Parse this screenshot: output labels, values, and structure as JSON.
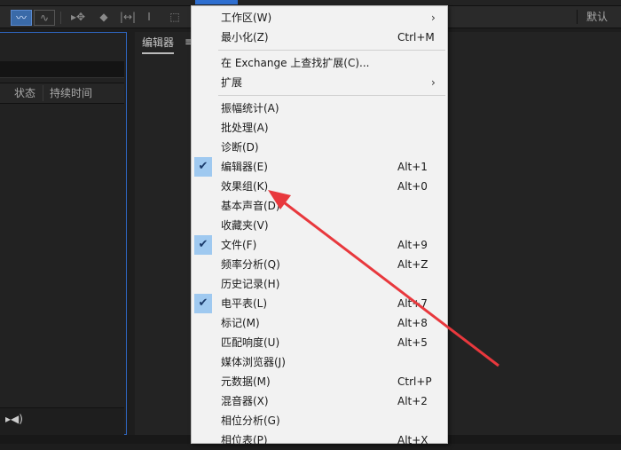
{
  "toolbar": {
    "default_label": "默认"
  },
  "left_panel": {
    "columns": [
      "状态",
      "持续时间"
    ]
  },
  "editor_panel": {
    "tab_label": "编辑器",
    "menu_icon": "≡"
  },
  "window_menu": {
    "items": [
      {
        "label": "工作区(W)",
        "shortcut": "",
        "submenu": true,
        "checked": false
      },
      {
        "label": "最小化(Z)",
        "shortcut": "Ctrl+M",
        "submenu": false,
        "checked": false
      },
      {
        "label": "在 Exchange 上查找扩展(C)...",
        "shortcut": "",
        "submenu": false,
        "checked": false
      },
      {
        "label": "扩展",
        "shortcut": "",
        "submenu": true,
        "checked": false
      },
      {
        "label": "振幅统计(A)",
        "shortcut": "",
        "submenu": false,
        "checked": false
      },
      {
        "label": "批处理(A)",
        "shortcut": "",
        "submenu": false,
        "checked": false
      },
      {
        "label": "诊断(D)",
        "shortcut": "",
        "submenu": false,
        "checked": false
      },
      {
        "label": "编辑器(E)",
        "shortcut": "Alt+1",
        "submenu": false,
        "checked": true
      },
      {
        "label": "效果组(K)",
        "shortcut": "Alt+0",
        "submenu": false,
        "checked": false
      },
      {
        "label": "基本声音(D)",
        "shortcut": "",
        "submenu": false,
        "checked": false
      },
      {
        "label": "收藏夹(V)",
        "shortcut": "",
        "submenu": false,
        "checked": false
      },
      {
        "label": "文件(F)",
        "shortcut": "Alt+9",
        "submenu": false,
        "checked": true
      },
      {
        "label": "频率分析(Q)",
        "shortcut": "Alt+Z",
        "submenu": false,
        "checked": false
      },
      {
        "label": "历史记录(H)",
        "shortcut": "",
        "submenu": false,
        "checked": false
      },
      {
        "label": "电平表(L)",
        "shortcut": "Alt+7",
        "submenu": false,
        "checked": true
      },
      {
        "label": "标记(M)",
        "shortcut": "Alt+8",
        "submenu": false,
        "checked": false
      },
      {
        "label": "匹配响度(U)",
        "shortcut": "Alt+5",
        "submenu": false,
        "checked": false
      },
      {
        "label": "媒体浏览器(J)",
        "shortcut": "",
        "submenu": false,
        "checked": false
      },
      {
        "label": "元数据(M)",
        "shortcut": "Ctrl+P",
        "submenu": false,
        "checked": false
      },
      {
        "label": "混音器(X)",
        "shortcut": "Alt+2",
        "submenu": false,
        "checked": false
      },
      {
        "label": "相位分析(G)",
        "shortcut": "",
        "submenu": false,
        "checked": false
      },
      {
        "label": "相位表(P)",
        "shortcut": "Alt+X",
        "submenu": false,
        "checked": false
      }
    ]
  },
  "annotation": {
    "arrow_color": "#e8383d",
    "target": "效果组(K)"
  }
}
